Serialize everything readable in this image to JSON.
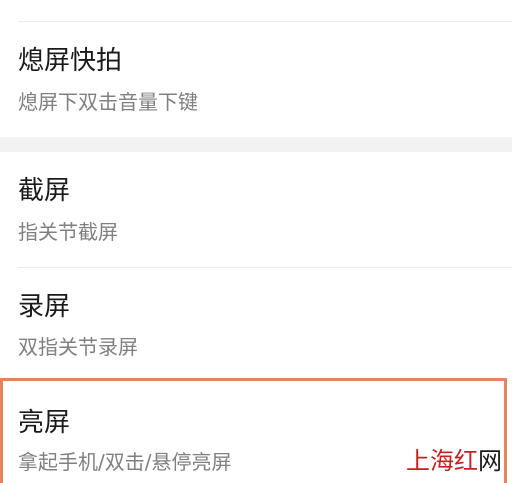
{
  "settings": {
    "items": [
      {
        "title": "熄屏快拍",
        "subtitle": "熄屏下双击音量下键"
      },
      {
        "title": "截屏",
        "subtitle": "指关节截屏"
      },
      {
        "title": "录屏",
        "subtitle": "双指关节录屏"
      },
      {
        "title": "亮屏",
        "subtitle": "拿起手机/双击/悬停亮屏"
      }
    ]
  },
  "watermark": {
    "text_red": "上海红",
    "text_black": "网"
  },
  "colors": {
    "highlight_border": "#e8825e",
    "section_gap": "#f2f2f2",
    "watermark_red": "#c8201e"
  }
}
